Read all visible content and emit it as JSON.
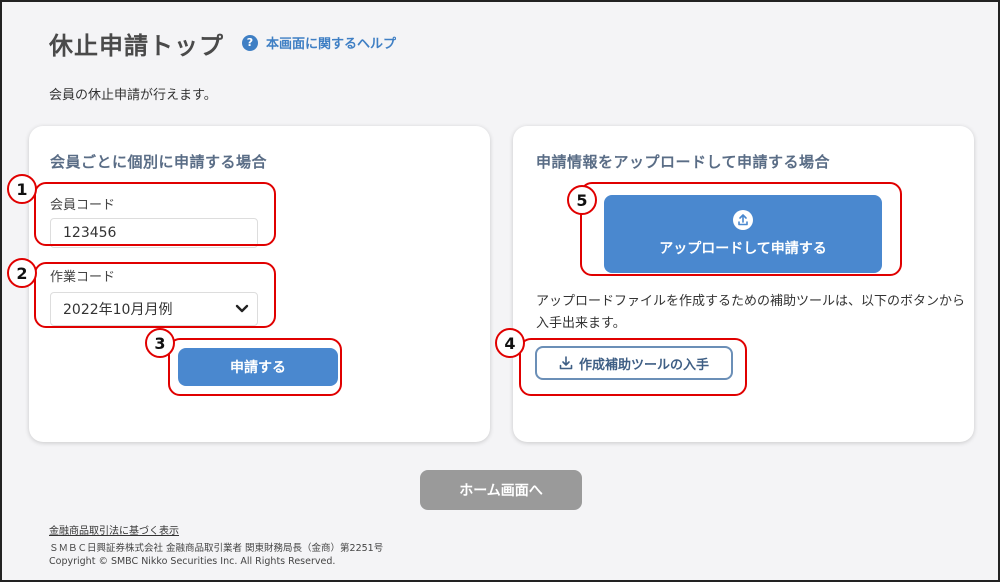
{
  "header": {
    "title": "休止申請トップ",
    "help_icon": "?",
    "help_link": "本画面に関するヘルプ"
  },
  "description": "会員の休止申請が行えます。",
  "individual": {
    "title": "会員ごとに個別に申請する場合",
    "member_code_label": "会員コード",
    "member_code_value": "123456",
    "work_code_label": "作業コード",
    "work_code_value": "2022年10月月例",
    "submit_label": "申請する"
  },
  "upload": {
    "title": "申請情報をアップロードして申請する場合",
    "upload_button_label": "アップロードして申請する",
    "description": "アップロードファイルを作成するための補助ツールは、以下のボタンから入手出来ます。",
    "tool_button_label": "作成補助ツールの入手"
  },
  "home_button_label": "ホーム画面へ",
  "footer": {
    "link": "金融商品取引法に基づく表示",
    "company": "ＳＭＢＣ日興証券株式会社 金融商品取引業者 関東財務局長（金商）第2251号",
    "copyright": "Copyright © SMBC Nikko Securities Inc. All Rights Reserved."
  },
  "annotations": [
    "1",
    "2",
    "3",
    "4",
    "5"
  ],
  "colors": {
    "primary": "#4a88cf",
    "annotation_red": "#e00000",
    "gray_button": "#9a9a9a"
  },
  "icons": {
    "help": "help-icon",
    "dropdown": "chevron-down-icon",
    "upload": "upload-icon",
    "download": "download-icon"
  }
}
